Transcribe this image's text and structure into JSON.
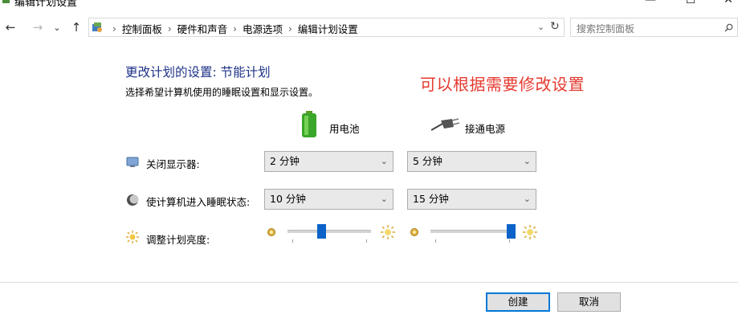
{
  "window": {
    "title": "编辑计划设置",
    "controls": {
      "minimize": "—",
      "maximize": "☐",
      "close": "✕"
    }
  },
  "address_bar": {
    "breadcrumbs": [
      "控制面板",
      "硬件和声音",
      "电源选项",
      "编辑计划设置"
    ],
    "search_placeholder": "搜索控制面板"
  },
  "main": {
    "heading": "更改计划的设置: 节能计划",
    "subheading": "选择希望计算机使用的睡眠设置和显示设置。",
    "annotation": "可以根据需要修改设置",
    "columns": {
      "battery": "用电池",
      "plugged_in": "接通电源"
    },
    "rows": {
      "display_off": {
        "label": "关闭显示器:",
        "battery": "2 分钟",
        "plugged_in": "5 分钟"
      },
      "sleep": {
        "label": "使计算机进入睡眠状态:",
        "battery": "10 分钟",
        "plugged_in": "15 分钟"
      },
      "brightness": {
        "label": "调整计划亮度:",
        "battery_level": 0.4,
        "plugged_in_level": 0.96
      }
    }
  },
  "footer": {
    "create": "创建",
    "cancel": "取消"
  },
  "colors": {
    "heading": "#1e3287",
    "annotation": "#e53a2f",
    "slider_thumb": "#0b63c9",
    "primary_border": "#0078d7"
  }
}
